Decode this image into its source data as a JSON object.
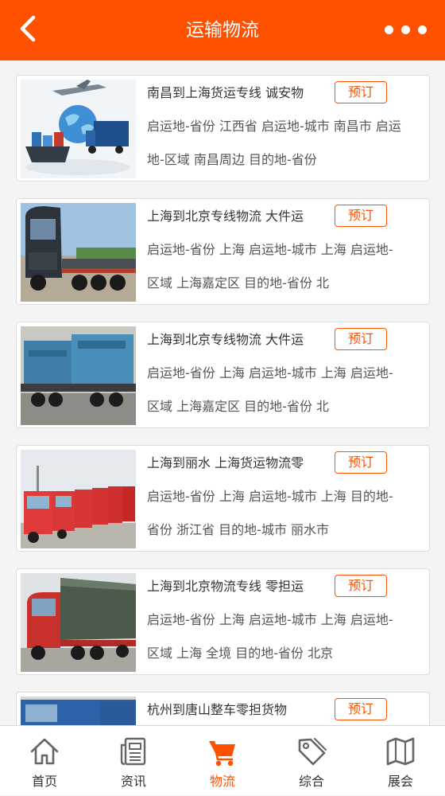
{
  "header": {
    "title": "运输物流",
    "back_icon": "chevron-left-icon",
    "more_icon": "more-dots-icon",
    "color": "#ff5100"
  },
  "listings": [
    {
      "title": "南昌到上海货运专线 诚安物",
      "desc": "启运地-省份 江西省 启运地-城市 南昌市 启运地-区域 南昌周边 目的地-省份",
      "button": "预订",
      "image": "global-logistics-image"
    },
    {
      "title": "上海到北京专线物流 大件运",
      "desc": "启运地-省份 上海 启运地-城市 上海 启运地-区域 上海嘉定区 目的地-省份 北",
      "button": "预订",
      "image": "dark-truck-image"
    },
    {
      "title": "上海到北京专线物流 大件运",
      "desc": "启运地-省份 上海 启运地-城市 上海 启运地-区域 上海嘉定区 目的地-省份 北",
      "button": "预订",
      "image": "flatbed-machinery-image"
    },
    {
      "title": "上海到丽水 上海货运物流零",
      "desc": "启运地-省份 上海 启运地-城市 上海 目的地-省份 浙江省 目的地-城市 丽水市",
      "button": "预订",
      "image": "red-truck-fleet-image"
    },
    {
      "title": "上海到北京物流专线 零担运",
      "desc": "启运地-省份 上海 启运地-城市 上海 启运地-区域 上海 全境 目的地-省份 北京",
      "button": "预订",
      "image": "red-cargo-truck-image"
    },
    {
      "title": "杭州到唐山整车零担货物",
      "desc": "",
      "button": "预订",
      "image": "blue-truck-image"
    }
  ],
  "tabbar": {
    "active_color": "#ff5100",
    "items": [
      {
        "label": "首页",
        "icon": "home-icon"
      },
      {
        "label": "资讯",
        "icon": "news-icon"
      },
      {
        "label": "物流",
        "icon": "cart-icon"
      },
      {
        "label": "综合",
        "icon": "tag-icon"
      },
      {
        "label": "展会",
        "icon": "map-icon"
      }
    ]
  }
}
